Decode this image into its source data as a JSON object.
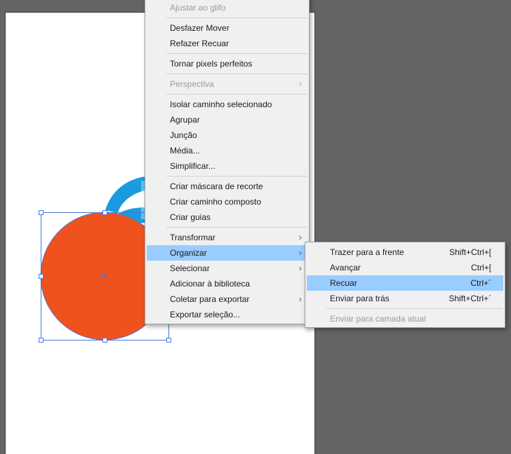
{
  "colors": {
    "canvas_bg": "#646464",
    "artboard": "#ffffff",
    "circle_fill": "#f0521e",
    "selection": "#4a78d8",
    "text_art": "#1a9be0",
    "menu_bg": "#f0f0f0",
    "menu_highlight": "#99ccff",
    "disabled_text": "#9a9a9a"
  },
  "context_menu": {
    "items": [
      {
        "label": "Ajustar ao glifo",
        "disabled": true
      },
      {
        "label": "Desfazer Mover"
      },
      {
        "label": "Refazer Recuar"
      },
      {
        "label": "Tornar pixels perfeitos"
      },
      {
        "label": "Perspectiva",
        "disabled": true,
        "submenu": true
      },
      {
        "label": "Isolar caminho selecionado"
      },
      {
        "label": "Agrupar"
      },
      {
        "label": "Junção"
      },
      {
        "label": "Média..."
      },
      {
        "label": "Simplificar..."
      },
      {
        "label": "Criar máscara de recorte"
      },
      {
        "label": "Criar caminho composto"
      },
      {
        "label": "Criar guias"
      },
      {
        "label": "Transformar",
        "submenu": true
      },
      {
        "label": "Organizar",
        "submenu": true,
        "highlighted": true
      },
      {
        "label": "Selecionar",
        "submenu": true
      },
      {
        "label": "Adicionar à biblioteca"
      },
      {
        "label": "Coletar para exportar",
        "submenu": true
      },
      {
        "label": "Exportar seleção..."
      }
    ],
    "submenu_arrow": "›"
  },
  "arrange_submenu": {
    "items": [
      {
        "label": "Trazer para a frente",
        "shortcut": "Shift+Ctrl+["
      },
      {
        "label": "Avançar",
        "shortcut": "Ctrl+["
      },
      {
        "label": "Recuar",
        "shortcut": "Ctrl+´",
        "highlighted": true
      },
      {
        "label": "Enviar para trás",
        "shortcut": "Shift+Ctrl+´"
      },
      {
        "label": "Enviar para camada atual",
        "disabled": true
      }
    ]
  }
}
